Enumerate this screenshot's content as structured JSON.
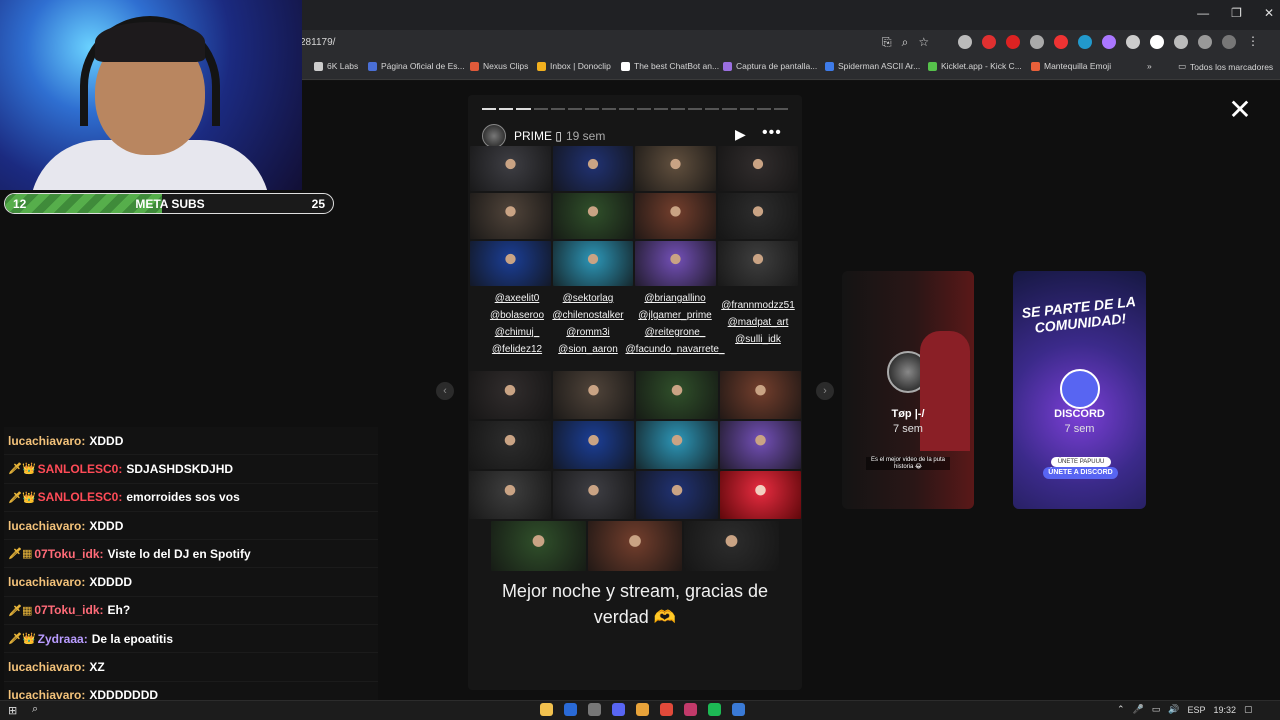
{
  "browser": {
    "url": "281179/",
    "window_controls": [
      "—",
      "❐",
      "✕"
    ],
    "bookmarks": [
      {
        "label": "6K Labs",
        "color": "#cccccc"
      },
      {
        "label": "Página Oficial de Es...",
        "color": "#4a6fd6"
      },
      {
        "label": "Nexus Clips",
        "color": "#e05a3a"
      },
      {
        "label": "Inbox | Donoclip",
        "color": "#f2b01e"
      },
      {
        "label": "The best ChatBot an...",
        "color": "#ffffff"
      },
      {
        "label": "Captura de pantalla...",
        "color": "#9a6fe0"
      },
      {
        "label": "Spiderman ASCII Ar...",
        "color": "#3e7be8"
      },
      {
        "label": "Kicklet.app - Kick C...",
        "color": "#56c14b"
      },
      {
        "label": "Mantequilla Emoji",
        "color": "#e8603a"
      }
    ],
    "bookmarks_more": "»",
    "bookmarks_all": "Todos los marcadores"
  },
  "stream": {
    "sub_goal": {
      "label": "META SUBS",
      "current": "12",
      "target": "25",
      "progress_fraction": 0.48
    },
    "chat": [
      {
        "badges": "",
        "user": "lucachiavaro:",
        "user_color": "#f3c27a",
        "text": "XDDD"
      },
      {
        "badges": "🗡👑",
        "user": "SANLOLESC0:",
        "user_color": "#ff4b57",
        "text": "SDJASHDSKDJHD"
      },
      {
        "badges": "🗡👑",
        "user": "SANLOLESC0:",
        "user_color": "#ff4b57",
        "text": "emorroides sos vos"
      },
      {
        "badges": "",
        "user": "lucachiavaro:",
        "user_color": "#f3c27a",
        "text": "XDDD"
      },
      {
        "badges": "🗡▦",
        "user": "07Toku_idk:",
        "user_color": "#ff6b78",
        "text": "Viste lo del DJ en Spotify"
      },
      {
        "badges": "",
        "user": "lucachiavaro:",
        "user_color": "#f3c27a",
        "text": "XDDDD"
      },
      {
        "badges": "🗡▦",
        "user": "07Toku_idk:",
        "user_color": "#ff6b78",
        "text": "Eh?"
      },
      {
        "badges": "🗡👑",
        "user": "Zydraaa:",
        "user_color": "#b99cff",
        "text": "De la epoatitis"
      },
      {
        "badges": "",
        "user": "lucachiavaro:",
        "user_color": "#f3c27a",
        "text": "XZ"
      },
      {
        "badges": "",
        "user": "lucachiavaro:",
        "user_color": "#f3c27a",
        "text": "XDDDDDDD"
      }
    ]
  },
  "story": {
    "user": "PRIME ▯",
    "time": "19 sem",
    "segments_total": 18,
    "segments_viewed": 3,
    "tags": [
      [
        "@axeelit0",
        "@bolaseroo",
        "@chimuj_",
        "@felidez12"
      ],
      [
        "@sektorlag",
        "@chilenostalker",
        "@romm3i",
        "@sion_aaron"
      ],
      [
        "@briangallino",
        "@jlgamer_prime",
        "@reitegrone_",
        "@facundo_navarrete_"
      ],
      [
        "@frannmodzz51",
        "@madpat_art",
        "@sulli_idk"
      ]
    ],
    "caption_line1": "Mejor noche y stream, gracias de",
    "caption_line2": "verdad 🫶"
  },
  "side_stories": [
    {
      "name": "Tøp |-/",
      "time": "7 sem",
      "note": "Es el mejor video de la puta historia 😂"
    },
    {
      "name": "DISCORD",
      "time": "7 sem",
      "headline": "SE PARTE DE LA COMUNIDAD!",
      "btn1": "ÚNETE PAPUUU",
      "btn2": "ÚNETE A DISCORD"
    }
  ],
  "taskbar": {
    "lang": "ESP",
    "time": "19:32"
  }
}
